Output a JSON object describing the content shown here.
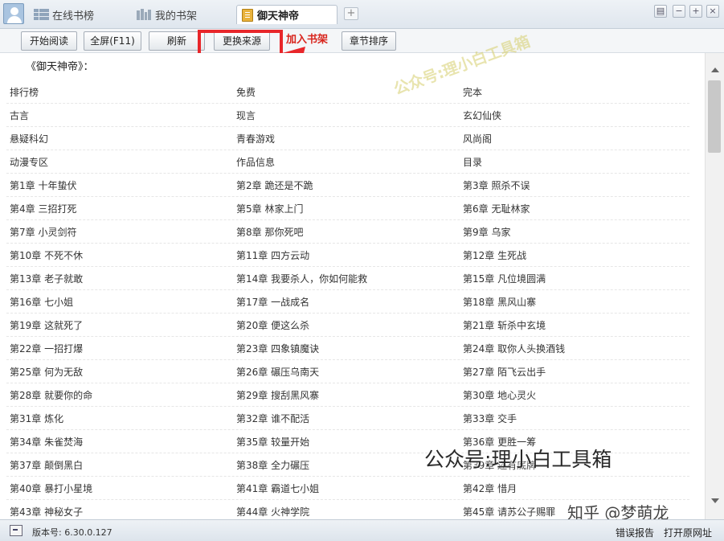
{
  "tabs": [
    {
      "label": "在线书榜",
      "icon": "list-grid-icon"
    },
    {
      "label": "我的书架",
      "icon": "bookshelf-icon"
    },
    {
      "label": "御天神帝",
      "icon": "book-icon",
      "active": true
    }
  ],
  "tab_add_label": "+",
  "window_controls": [
    "▤",
    "−",
    "+",
    "×"
  ],
  "toolbar": {
    "start_reading": "开始阅读",
    "fullscreen": "全屏(F11)",
    "refresh": "刷新",
    "change_source": "更换来源",
    "add_to_shelf": "加入书架",
    "chapter_sort": "章节排序"
  },
  "book_title": "《御天神帝》：",
  "table_rows": [
    [
      "排行榜",
      "免费",
      "完本"
    ],
    [
      "古言",
      "现言",
      "玄幻仙侠"
    ],
    [
      "悬疑科幻",
      "青春游戏",
      "风尚阁"
    ],
    [
      "动漫专区",
      "作品信息",
      "目录"
    ],
    [
      "第1章 十年蛰伏",
      "第2章 跪还是不跪",
      "第3章 照杀不误"
    ],
    [
      "第4章 三招打死",
      "第5章 林家上门",
      "第6章 无耻林家"
    ],
    [
      "第7章 小灵剑符",
      "第8章 那你死吧",
      "第9章 乌家"
    ],
    [
      "第10章 不死不休",
      "第11章 四方云动",
      "第12章 生死战"
    ],
    [
      "第13章 老子就敢",
      "第14章 我要杀人，你如何能救",
      "第15章 凡位境圆满"
    ],
    [
      "第16章 七小姐",
      "第17章 一战成名",
      "第18章 黑风山寨"
    ],
    [
      "第19章 这就死了",
      "第20章 便这么杀",
      "第21章 斩杀中玄境"
    ],
    [
      "第22章 一招打爆",
      "第23章 四象镇魔诀",
      "第24章 取你人头换酒钱"
    ],
    [
      "第25章 何为无敌",
      "第26章 碾压乌南天",
      "第27章 陌飞云出手"
    ],
    [
      "第28章 就要你的命",
      "第29章 搜刮黑风寨",
      "第30章 地心灵火"
    ],
    [
      "第31章 炼化",
      "第32章 谁不配活",
      "第33章 交手"
    ],
    [
      "第34章 朱雀焚海",
      "第35章 较量开始",
      "第36章 更胜一筹"
    ],
    [
      "第37章 颠倒黑白",
      "第38章 全力碾压",
      "第39章 还有底牌"
    ],
    [
      "第40章 暴打小星境",
      "第41章 霸道七小姐",
      "第42章 惜月"
    ],
    [
      "第43章 神秘女子",
      "第44章 火神学院",
      "第45章 请苏公子赐罪"
    ]
  ],
  "watermarks": {
    "diagonal": "公众号:理小白工具箱",
    "lower": "公众号:理小白工具箱",
    "corner": "知乎 @梦萌龙"
  },
  "status": {
    "version": "版本号: 6.30.0.127",
    "report_error": "错误报告",
    "open_source_url": "打开原网址"
  },
  "colors": {
    "highlight_red": "#e8262a",
    "add_to_shelf_red": "#d8251d",
    "tabbar_bg": "#dfe6ee"
  }
}
